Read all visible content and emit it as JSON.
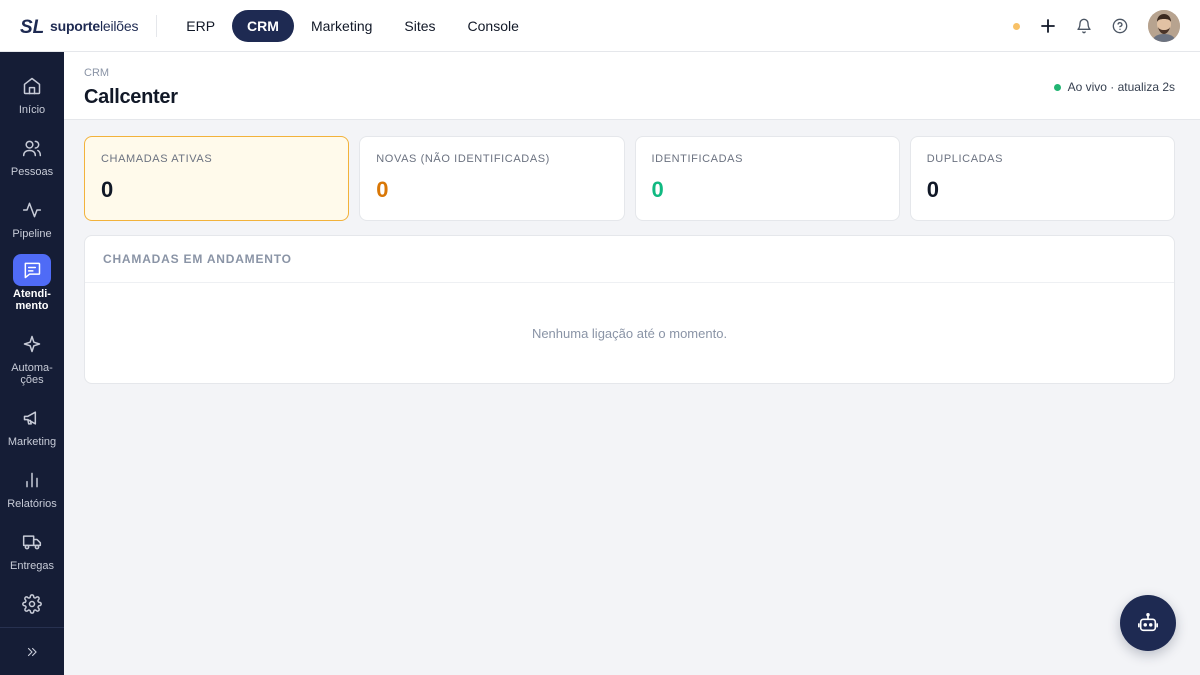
{
  "app": {
    "logo": {
      "mark": "SL",
      "brand_bold": "suporte",
      "brand_light": "leilões"
    },
    "top_nav": [
      {
        "label": "ERP",
        "active": false
      },
      {
        "label": "CRM",
        "active": true
      },
      {
        "label": "Marketing",
        "active": false
      },
      {
        "label": "Sites",
        "active": false
      },
      {
        "label": "Console",
        "active": false
      }
    ],
    "top_actions": [
      "status-dot",
      "plus-icon",
      "bell-icon",
      "help-icon",
      "avatar"
    ]
  },
  "sidebar": {
    "items": [
      {
        "label": "Início",
        "icon": "home-icon",
        "active": false
      },
      {
        "label": "Pessoas",
        "icon": "users-icon",
        "active": false
      },
      {
        "label": "Pipeline",
        "icon": "activity-icon",
        "active": false
      },
      {
        "label": "Atendi-\nmento",
        "icon": "chat-icon",
        "active": true
      },
      {
        "label": "Automa-\nções",
        "icon": "sparkle-icon",
        "active": false
      },
      {
        "label": "Marketing",
        "icon": "megaphone-icon",
        "active": false
      },
      {
        "label": "Relatórios",
        "icon": "bar-chart-icon",
        "active": false
      },
      {
        "label": "Entregas",
        "icon": "truck-icon",
        "active": false
      },
      {
        "label": "",
        "icon": "gear-icon",
        "active": false
      }
    ],
    "collapse_icon": "chevrons-right-icon"
  },
  "header": {
    "breadcrumb": "CRM",
    "title": "Callcenter",
    "live_status": "Ao vivo · atualiza 2s"
  },
  "stats": [
    {
      "label": "CHAMADAS ATIVAS",
      "value": "0",
      "color": "#111827",
      "highlight": true
    },
    {
      "label": "NOVAS (NÃO IDENTIFICADAS)",
      "value": "0",
      "color": "#d97706",
      "highlight": false
    },
    {
      "label": "IDENTIFICADAS",
      "value": "0",
      "color": "#10b981",
      "highlight": false
    },
    {
      "label": "DUPLICADAS",
      "value": "0",
      "color": "#111827",
      "highlight": false
    }
  ],
  "calls_panel": {
    "title": "CHAMADAS EM ANDAMENTO",
    "empty_text": "Nenhuma ligação até o momento."
  },
  "colors": {
    "brand_navy": "#1e2a52",
    "sidebar_bg": "#151d36",
    "active_accent": "#4f6bf6",
    "live_green": "#22b573",
    "pending_orange": "#f8c167"
  }
}
